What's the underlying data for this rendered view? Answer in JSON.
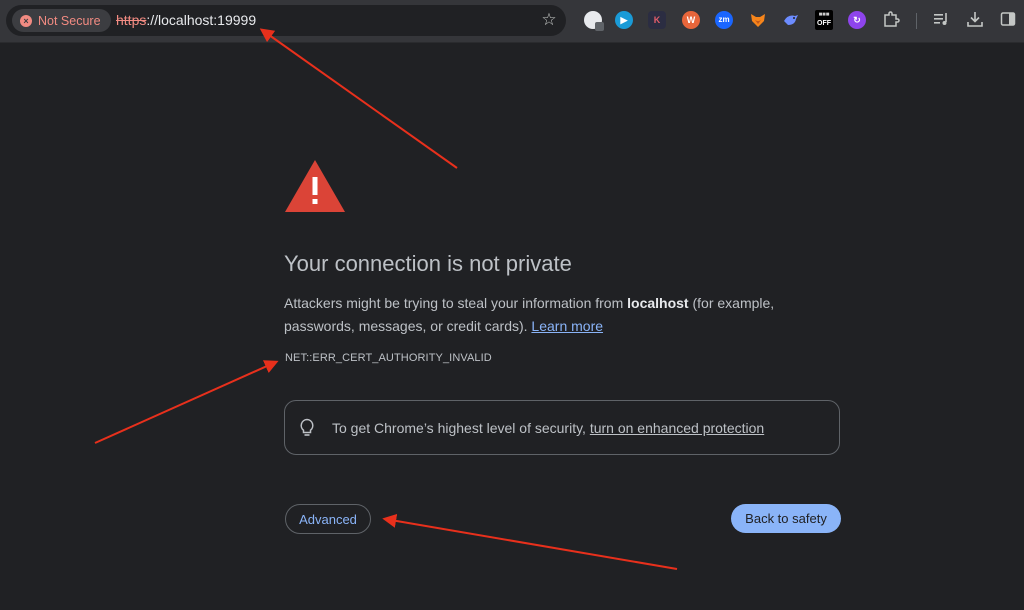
{
  "toolbar": {
    "security_chip": {
      "label": "Not Secure",
      "icon": "error-x-icon",
      "color": "#f28b82"
    },
    "url": {
      "scheme": "https",
      "rest": "://localhost:19999"
    },
    "bookmark_icon": "star-icon",
    "extensions": [
      {
        "name": "ext-cloud-icon",
        "glyph": "",
        "color": "#e8eaed"
      },
      {
        "name": "ext-play-icon",
        "glyph": "▶",
        "color": "#1a9bd7"
      },
      {
        "name": "ext-k-icon",
        "glyph": "K",
        "color": "#2b2d42"
      },
      {
        "name": "ext-wordpress-icon",
        "glyph": "W",
        "color": "#e8663b"
      },
      {
        "name": "ext-zm-icon",
        "glyph": "zm",
        "color": "#1a66ff"
      },
      {
        "name": "ext-fox-icon",
        "glyph": "",
        "color": "#f6851b"
      },
      {
        "name": "ext-bird-icon",
        "glyph": "",
        "color": "#6c8cff"
      },
      {
        "name": "ext-off-badge-icon",
        "glyph": "OFF",
        "color": "#000000"
      },
      {
        "name": "ext-purple-icon",
        "glyph": "↻",
        "color": "#8e44ec"
      }
    ],
    "tools": [
      "extensions-puzzle-icon",
      "reading-list-icon",
      "download-icon",
      "side-panel-icon"
    ]
  },
  "page": {
    "title": "Your connection is not private",
    "body_before": "Attackers might be trying to steal your information from ",
    "host": "localhost",
    "body_after": " (for example, passwords, messages, or credit cards). ",
    "learn_more": "Learn more",
    "error_code": "NET::ERR_CERT_AUTHORITY_INVALID",
    "enhanced_prefix": "To get Chrome’s highest level of security, ",
    "enhanced_link": "turn on enhanced protection",
    "advanced_label": "Advanced",
    "back_label": "Back to safety"
  },
  "colors": {
    "background": "#202124",
    "warning": "#db4437",
    "link": "#8ab4f8",
    "annotation_arrow": "#e8301c"
  }
}
